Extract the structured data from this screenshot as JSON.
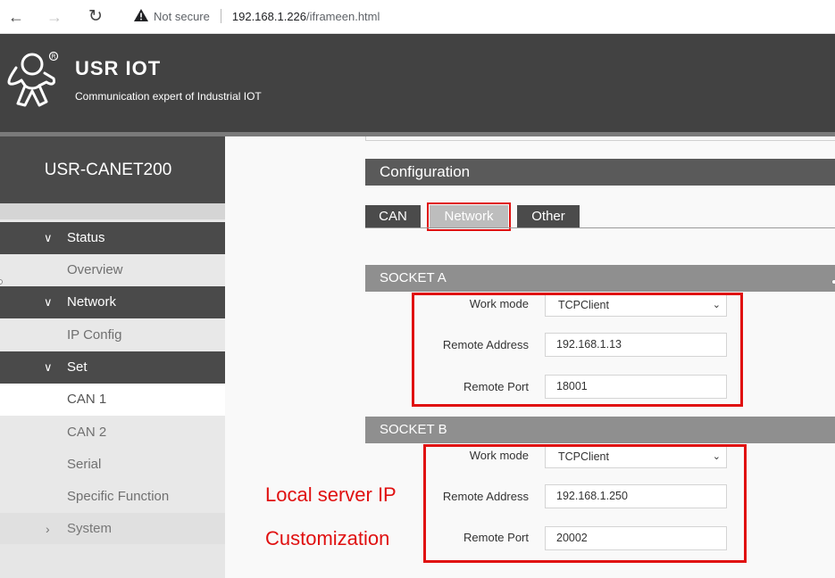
{
  "browser": {
    "back_glyph": "←",
    "forward_glyph": "→",
    "reload_glyph": "↻",
    "not_secure": "Not secure",
    "url_host": "192.168.1.226",
    "url_path": "/iframeen.html"
  },
  "header": {
    "brand": "USR IOT",
    "tagline": "Communication expert of Industrial IOT",
    "logo_icon": "usr-figure-logo",
    "bg_color": "#424242"
  },
  "sidebar": {
    "device_name": "USR-CANET200",
    "menu": [
      {
        "type": "group",
        "chevron": "∨",
        "label": "Status"
      },
      {
        "type": "sub",
        "label": "Overview"
      },
      {
        "type": "group",
        "chevron": "∨",
        "label": "Network"
      },
      {
        "type": "sub",
        "label": "IP Config"
      },
      {
        "type": "group",
        "chevron": "∨",
        "label": "Set"
      },
      {
        "type": "sub",
        "label": "CAN 1",
        "active": true
      },
      {
        "type": "sub",
        "label": "CAN 2"
      },
      {
        "type": "sub",
        "label": "Serial"
      },
      {
        "type": "sub",
        "label": "Specific Function"
      },
      {
        "type": "closed",
        "chevron": "›",
        "label": "System"
      }
    ]
  },
  "main": {
    "config_title": "Configuration",
    "tabs": [
      {
        "label": "CAN"
      },
      {
        "label": "Network",
        "active": true
      },
      {
        "label": "Other"
      }
    ],
    "socket_a": {
      "title": "SOCKET A",
      "work_mode_label": "Work mode",
      "work_mode_value": "TCPClient",
      "remote_address_label": "Remote Address",
      "remote_address_value": "192.168.1.13",
      "remote_port_label": "Remote Port",
      "remote_port_value": "18001"
    },
    "socket_b": {
      "title": "SOCKET B",
      "work_mode_label": "Work mode",
      "work_mode_value": "TCPClient",
      "remote_address_label": "Remote Address",
      "remote_address_value": "192.168.1.250",
      "remote_port_label": "Remote Port",
      "remote_port_value": "20002"
    },
    "annotations": {
      "local_server_ip": "Local server IP",
      "customization": "Customization",
      "color": "#e01010"
    },
    "dropdown_glyph": "⌄"
  }
}
